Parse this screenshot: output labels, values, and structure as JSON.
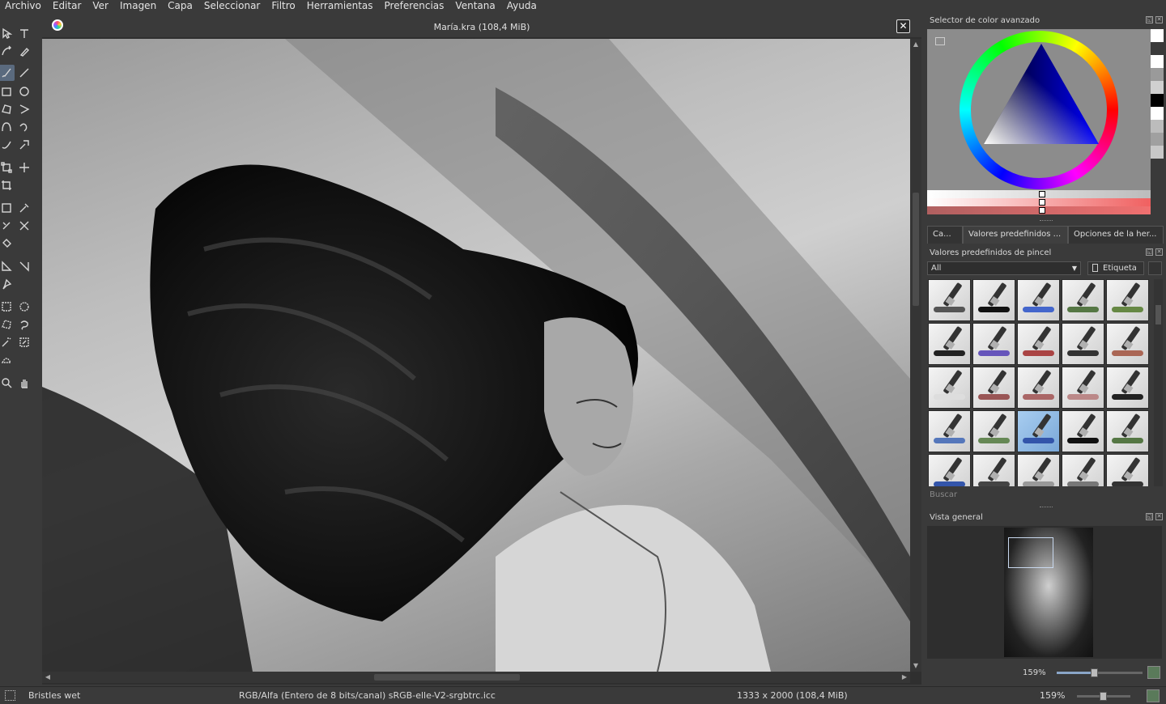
{
  "menu": [
    "Archivo",
    "Editar",
    "Ver",
    "Imagen",
    "Capa",
    "Seleccionar",
    "Filtro",
    "Herramientas",
    "Preferencias",
    "Ventana",
    "Ayuda"
  ],
  "tools": [
    {
      "name": "select-shapes-tool",
      "icon": "arrow-icon"
    },
    {
      "name": "text-tool",
      "icon": "text-icon"
    },
    {
      "name": "edit-shapes-tool",
      "icon": "edit-shapes-icon"
    },
    {
      "name": "calligraphy-tool",
      "icon": "calligraphy-icon"
    },
    {
      "name": "freehand-brush-tool",
      "icon": "brush-icon"
    },
    {
      "name": "line-tool",
      "icon": "line-icon"
    },
    {
      "name": "rectangle-tool",
      "icon": "rectangle-icon"
    },
    {
      "name": "ellipse-tool",
      "icon": "ellipse-icon"
    },
    {
      "name": "polygon-tool",
      "icon": "polygon-icon"
    },
    {
      "name": "polyline-tool",
      "icon": "polyline-icon"
    },
    {
      "name": "bezier-tool",
      "icon": "bezier-icon"
    },
    {
      "name": "freehand-path-tool",
      "icon": "freehand-path-icon"
    },
    {
      "name": "dynamic-brush-tool",
      "icon": "dynamic-brush-icon"
    },
    {
      "name": "multibrush-tool",
      "icon": "multibrush-icon"
    },
    {
      "name": "transform-tool",
      "icon": "transform-icon"
    },
    {
      "name": "move-tool",
      "icon": "move-icon"
    },
    {
      "name": "crop-tool",
      "icon": "crop-icon"
    },
    {
      "name": "gradient-tool",
      "icon": "gradient-icon"
    },
    {
      "name": "color-picker-tool",
      "icon": "eyedropper-icon"
    },
    {
      "name": "colorize-mask-tool",
      "icon": "colorize-icon"
    },
    {
      "name": "smart-patch-tool",
      "icon": "smart-patch-icon"
    },
    {
      "name": "fill-tool",
      "icon": "bucket-icon"
    },
    {
      "name": "assistant-tool",
      "icon": "assistant-icon"
    },
    {
      "name": "measure-tool",
      "icon": "measure-icon"
    },
    {
      "name": "reference-tool",
      "icon": "pin-icon"
    },
    {
      "name": "rect-select-tool",
      "icon": "rect-select-icon"
    },
    {
      "name": "ellipse-select-tool",
      "icon": "ellipse-select-icon"
    },
    {
      "name": "polygon-select-tool",
      "icon": "polygon-select-icon"
    },
    {
      "name": "freehand-select-tool",
      "icon": "lasso-icon"
    },
    {
      "name": "contiguous-select-tool",
      "icon": "magic-wand-icon"
    },
    {
      "name": "similar-select-tool",
      "icon": "similar-select-icon"
    },
    {
      "name": "bezier-select-tool",
      "icon": "bezier-select-icon"
    },
    {
      "name": "zoom-tool",
      "icon": "zoom-icon"
    },
    {
      "name": "pan-tool",
      "icon": "hand-icon"
    }
  ],
  "document": {
    "title": "María.kra (108,4 MiB)",
    "close_label": "✕"
  },
  "color_selector": {
    "title": "Selector de color avanzado",
    "history": [
      "#ffffff",
      "#3a3a3a",
      "#ffffff",
      "#9a9a9a",
      "#d0d0d0",
      "#000000",
      "#ffffff",
      "#bcbcbc",
      "#a0a0a0",
      "#c8c8c8"
    ]
  },
  "tabs": [
    "Ca...",
    "Valores predefinidos ...",
    "Opciones de la her..."
  ],
  "presets": {
    "title": "Valores predefinidos de pincel",
    "filter": "All",
    "tag_label": "Etiqueta",
    "search_label": "Buscar",
    "items": [
      {
        "name": "preset-ink-grey",
        "stroke": "#555555"
      },
      {
        "name": "preset-marker-black",
        "stroke": "#111111"
      },
      {
        "name": "preset-blue-wet",
        "stroke": "#4466cc"
      },
      {
        "name": "preset-green-bristle",
        "stroke": "#557744"
      },
      {
        "name": "preset-green-paint",
        "stroke": "#668844"
      },
      {
        "name": "preset-marker-black-2",
        "stroke": "#222222"
      },
      {
        "name": "preset-marker-purple",
        "stroke": "#6655bb"
      },
      {
        "name": "preset-red-pen",
        "stroke": "#aa4444"
      },
      {
        "name": "preset-dark-bristle",
        "stroke": "#333333"
      },
      {
        "name": "preset-red-smudge",
        "stroke": "#aa6655"
      },
      {
        "name": "preset-white-blend",
        "stroke": "#dddddd"
      },
      {
        "name": "preset-red-bristle",
        "stroke": "#995555"
      },
      {
        "name": "preset-red-texture",
        "stroke": "#aa6666"
      },
      {
        "name": "preset-sponge",
        "stroke": "#bb8888"
      },
      {
        "name": "preset-black-flat",
        "stroke": "#222222"
      },
      {
        "name": "preset-blue-bristles",
        "stroke": "#5577bb"
      },
      {
        "name": "preset-green-flat",
        "stroke": "#668855"
      },
      {
        "name": "preset-blue-selected",
        "stroke": "#3355aa"
      },
      {
        "name": "preset-black-bristle",
        "stroke": "#111111"
      },
      {
        "name": "preset-green-wet",
        "stroke": "#557744"
      },
      {
        "name": "preset-blue-pencil",
        "stroke": "#3355aa"
      },
      {
        "name": "preset-pencil-dark",
        "stroke": "#444444"
      },
      {
        "name": "preset-pencil-light",
        "stroke": "#999999"
      },
      {
        "name": "preset-pencil-grey",
        "stroke": "#777777"
      },
      {
        "name": "preset-pencil-black",
        "stroke": "#333333"
      }
    ]
  },
  "overview": {
    "title": "Vista general",
    "zoom": "159%"
  },
  "status": {
    "brush": "Bristles wet",
    "color_model": "RGB/Alfa (Entero de 8 bits/canal)  sRGB-elle-V2-srgbtrc.icc",
    "dimensions": "1333 x 2000 (108,4 MiB)",
    "zoom": "159%"
  }
}
